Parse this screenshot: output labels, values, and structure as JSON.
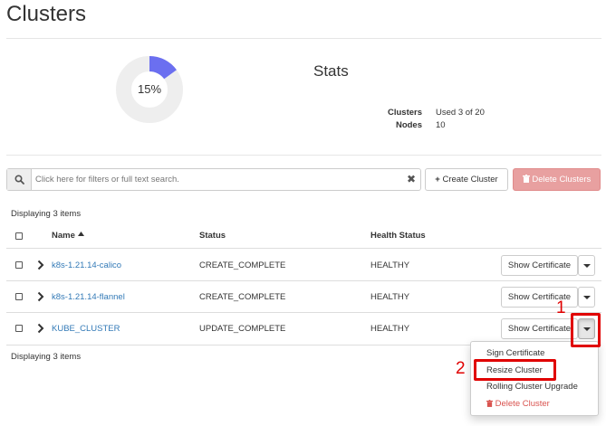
{
  "page": {
    "title": "Clusters"
  },
  "quota": {
    "percent_label": "15%",
    "used_fraction": 0.15
  },
  "stats": {
    "title": "Stats",
    "rows": [
      {
        "label": "Clusters",
        "value": "Used 3 of 20"
      },
      {
        "label": "Nodes",
        "value": "10"
      }
    ]
  },
  "toolbar": {
    "search_placeholder": "Click here for filters or full text search.",
    "clear_symbol": "✖",
    "create_label": "Create Cluster",
    "delete_label": "Delete Clusters"
  },
  "table": {
    "count_text": "Displaying 3 items",
    "columns": {
      "name": "Name",
      "status": "Status",
      "health": "Health Status"
    },
    "rows": [
      {
        "name": "k8s-1.21.14-calico",
        "status": "CREATE_COMPLETE",
        "health": "HEALTHY",
        "action": "Show Certificate"
      },
      {
        "name": "k8s-1.21.14-flannel",
        "status": "CREATE_COMPLETE",
        "health": "HEALTHY",
        "action": "Show Certificate"
      },
      {
        "name": "KUBE_CLUSTER",
        "status": "UPDATE_COMPLETE",
        "health": "HEALTHY",
        "action": "Show Certificate"
      }
    ]
  },
  "dropdown": {
    "items": [
      {
        "label": "Sign Certificate"
      },
      {
        "label": "Resize Cluster"
      },
      {
        "label": "Rolling Cluster Upgrade"
      },
      {
        "label": "Delete Cluster"
      }
    ]
  },
  "annotations": {
    "step1": "1",
    "step2": "2"
  },
  "colors": {
    "donut_used": "#6b6ff0",
    "donut_free": "#eeeeee",
    "link": "#337ab7",
    "danger": "#d9534f",
    "highlight": "#e00000"
  }
}
